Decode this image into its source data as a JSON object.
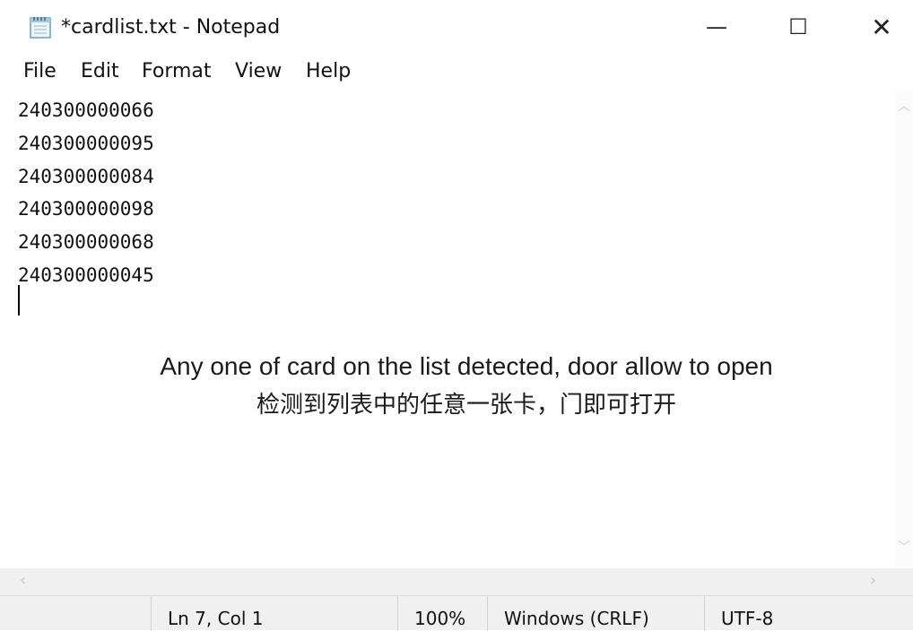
{
  "window": {
    "title": "*cardlist.txt - Notepad",
    "controls": {
      "minimize": "—",
      "maximize": "☐",
      "close": "✕"
    }
  },
  "menu": [
    "File",
    "Edit",
    "Format",
    "View",
    "Help"
  ],
  "editor": {
    "lines": [
      "240300000066",
      "240300000095",
      "240300000084",
      "240300000098",
      "240300000068",
      "240300000045"
    ]
  },
  "annotation": {
    "english": "Any one of card on the list detected, door allow to open",
    "chinese": "检测到列表中的任意一张卡，门即可打开"
  },
  "status": {
    "position": "Ln 7, Col 1",
    "zoom": "100%",
    "line_ending": "Windows (CRLF)",
    "encoding": "UTF-8"
  }
}
